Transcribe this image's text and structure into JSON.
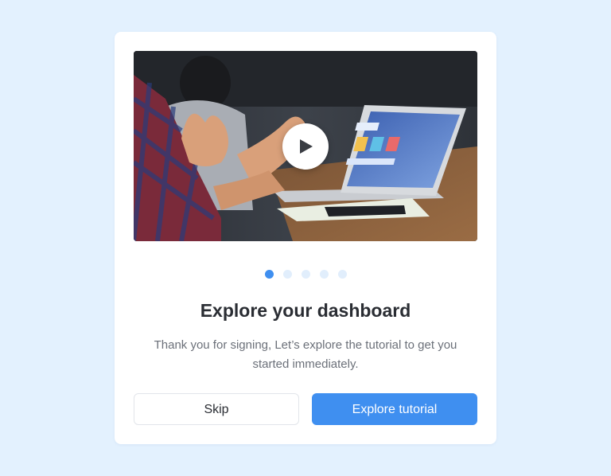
{
  "onboarding": {
    "video": {
      "thumbnail": "people-working-at-laptop",
      "play_icon": "play-icon"
    },
    "pager": {
      "total": 5,
      "active_index": 0
    },
    "title": "Explore your dashboard",
    "description": "Thank you for signing, Let’s explore the tutorial to get you started immediately.",
    "buttons": {
      "skip_label": "Skip",
      "explore_label": "Explore tutorial"
    }
  },
  "colors": {
    "page_background": "#e3f1fe",
    "card_background": "#ffffff",
    "accent": "#3f8ff0",
    "dot_inactive": "#e1eefc",
    "title_text": "#2a2d33",
    "body_text": "#6b7079"
  }
}
